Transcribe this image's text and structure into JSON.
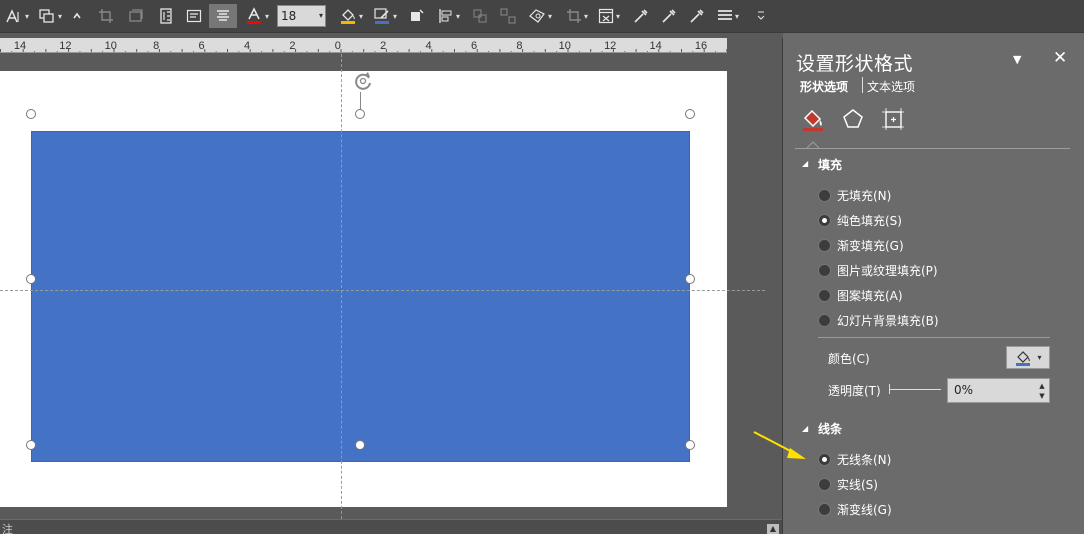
{
  "toolbar": {
    "font_size": "18",
    "icons": [
      "text-direction-icon",
      "arrange-icon",
      "collapse-icon",
      "crop-icon",
      "replace-picture-icon",
      "text-box-icon",
      "textbox-icon",
      "align-center-icon",
      "font-color-icon",
      "fill-color-icon",
      "outline-color-icon",
      "shape-effects-icon",
      "align-icon",
      "group-icon",
      "ungroup-icon",
      "edit-shape-icon",
      "crop-shape-icon",
      "picture-format-icon",
      "eyedropper-icon",
      "eyedropper-2-icon",
      "eyedropper-3-icon",
      "line-style-icon",
      "more-icon"
    ],
    "colors": {
      "font_color": "#ff0000",
      "fill_color": "#f7b500",
      "outline_color": "#4472c4"
    }
  },
  "ruler": {
    "labels": [
      "14",
      "12",
      "10",
      "8",
      "6",
      "4",
      "2",
      "0",
      "2",
      "4",
      "6",
      "8",
      "10",
      "12",
      "14",
      "16"
    ]
  },
  "slide": {
    "shape_color": "#4472c4",
    "background": "#ffffff"
  },
  "status": {
    "left_text": "注"
  },
  "panel": {
    "title": "设置形状格式",
    "tab_shape": "形状选项",
    "tab_text": "文本选项",
    "fill_section": "填充",
    "fill_options": [
      {
        "label": "无填充(N)",
        "selected": false
      },
      {
        "label": "纯色填充(S)",
        "selected": true
      },
      {
        "label": "渐变填充(G)",
        "selected": false
      },
      {
        "label": "图片或纹理填充(P)",
        "selected": false
      },
      {
        "label": "图案填充(A)",
        "selected": false
      },
      {
        "label": "幻灯片背景填充(B)",
        "selected": false
      }
    ],
    "color_label": "颜色(C)",
    "transparency_label": "透明度(T)",
    "transparency_value": "0%",
    "line_section": "线条",
    "line_options": [
      {
        "label": "无线条(N)",
        "selected": true
      },
      {
        "label": "实线(S)",
        "selected": false
      },
      {
        "label": "渐变线(G)",
        "selected": false
      }
    ],
    "accent_color": "#c0392b",
    "swatch_color": "#4472c4"
  },
  "annotation": {
    "arrow_color": "#ffe000"
  }
}
